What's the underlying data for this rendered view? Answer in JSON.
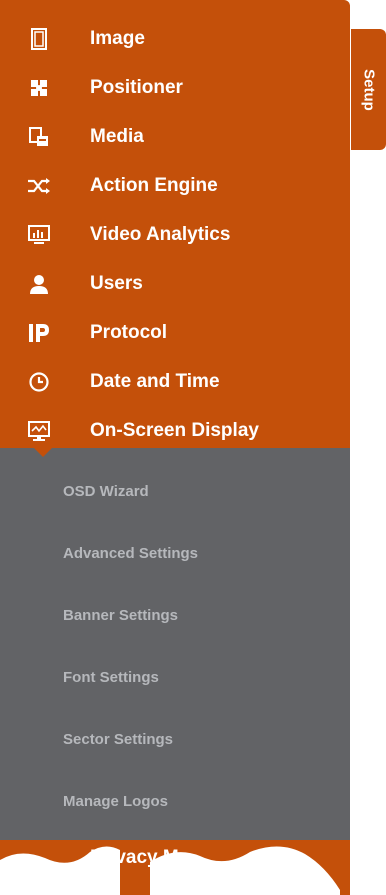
{
  "nav": {
    "items": [
      {
        "label": "Image",
        "icon": "film-icon"
      },
      {
        "label": "Positioner",
        "icon": "positioner-icon"
      },
      {
        "label": "Media",
        "icon": "media-icon"
      },
      {
        "label": "Action Engine",
        "icon": "shuffle-icon"
      },
      {
        "label": "Video Analytics",
        "icon": "analytics-icon"
      },
      {
        "label": "Users",
        "icon": "user-icon"
      },
      {
        "label": "Protocol",
        "icon": "ip-icon"
      },
      {
        "label": "Date and Time",
        "icon": "clock-icon"
      },
      {
        "label": "On-Screen Display",
        "icon": "monitor-icon"
      }
    ],
    "submenu": [
      {
        "label": "OSD Wizard"
      },
      {
        "label": "Advanced Settings"
      },
      {
        "label": "Banner Settings"
      },
      {
        "label": "Font Settings"
      },
      {
        "label": "Sector Settings"
      },
      {
        "label": "Manage Logos"
      }
    ],
    "partial_item": "Privacy Ma"
  },
  "setup_tab": {
    "label": "Setup"
  },
  "colors": {
    "accent": "#c4500a",
    "submenu_bg": "#626366",
    "submenu_text": "#b6b8bc"
  }
}
